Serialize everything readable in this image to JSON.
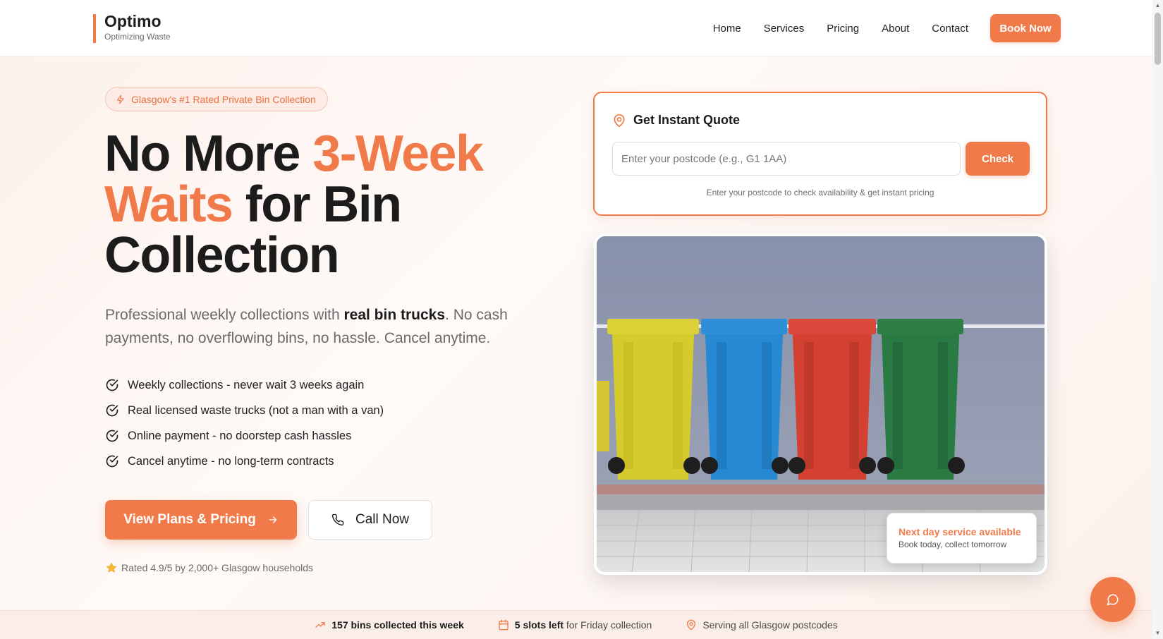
{
  "brand": {
    "name": "Optimo",
    "tagline": "Optimizing Waste"
  },
  "nav": {
    "items": [
      "Home",
      "Services",
      "Pricing",
      "About",
      "Contact"
    ],
    "cta": "Book Now"
  },
  "hero": {
    "badge": "Glasgow's #1 Rated Private Bin Collection",
    "headline": {
      "part1": "No More ",
      "accent1": "3-Week",
      "accent2": "Waits",
      "part2": " for Bin Collection"
    },
    "subtitle": {
      "before": "Professional weekly collections with ",
      "bold": "real bin trucks",
      "after": ". No cash payments, no overflowing bins, no hassle. Cancel anytime."
    },
    "features": [
      "Weekly collections - never wait 3 weeks again",
      "Real licensed waste trucks (not a man with a van)",
      "Online payment - no doorstep cash hassles",
      "Cancel anytime - no long-term contracts"
    ],
    "primary_cta": "View Plans & Pricing",
    "secondary_cta": "Call Now",
    "rating": "Rated 4.9/5 by 2,000+ Glasgow households"
  },
  "quote": {
    "title": "Get Instant Quote",
    "placeholder": "Enter your postcode (e.g., G1 1AA)",
    "value": "",
    "button": "Check",
    "hint": "Enter your postcode to check availability & get instant pricing"
  },
  "promo": {
    "title": "Next day service available",
    "subtitle": "Book today, collect tomorrow"
  },
  "stats": {
    "bins_bold": "157 bins collected this week",
    "slots_bold": "5 slots left",
    "slots_rest": " for Friday collection",
    "serving": "Serving all Glasgow postcodes"
  },
  "colors": {
    "accent": "#f07a4a",
    "text": "#1c1c1c",
    "muted": "#6a6a6a"
  },
  "icons": {
    "badge": "lightning-icon",
    "quote": "map-pin-icon",
    "feature": "check-circle-icon",
    "cta": "arrow-right-icon",
    "call": "phone-icon",
    "rating": "star-icon",
    "stat_bins": "trending-up-icon",
    "stat_slots": "calendar-icon",
    "stat_serving": "map-pin-icon",
    "chat": "chat-bubble-icon"
  }
}
